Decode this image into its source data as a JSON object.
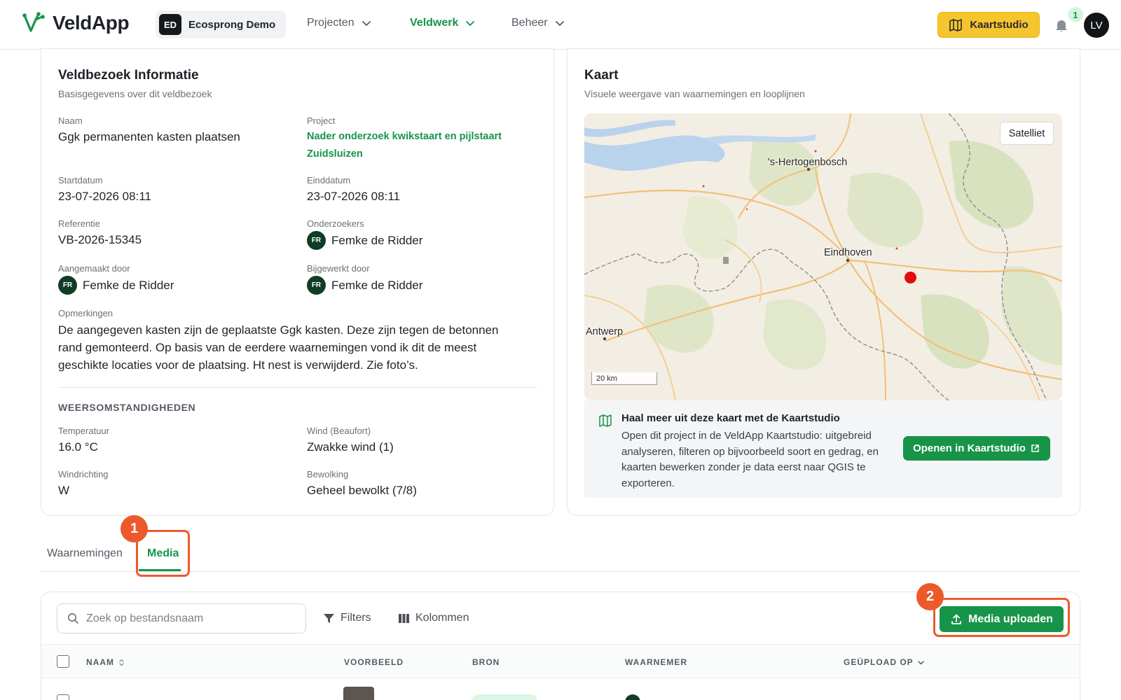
{
  "app": {
    "logo_text": "VeldApp",
    "org_initials": "ED",
    "org_name": "Ecosprong Demo"
  },
  "nav": {
    "items": [
      {
        "label": "Projecten",
        "active": false
      },
      {
        "label": "Veldwerk",
        "active": true
      },
      {
        "label": "Beheer",
        "active": false
      }
    ],
    "studio_button": "Kaartstudio",
    "notification_count": "1",
    "user_initials": "LV"
  },
  "info": {
    "title": "Veldbezoek Informatie",
    "subtitle": "Basisgegevens over dit veldbezoek",
    "naam_label": "Naam",
    "naam_value": "Ggk permanenten kasten plaatsen",
    "project_label": "Project",
    "project_value": "Nader onderzoek kwikstaart en pijlstaart Zuidsluizen",
    "startdatum_label": "Startdatum",
    "startdatum_value": "23-07-2026 08:11",
    "einddatum_label": "Einddatum",
    "einddatum_value": "23-07-2026 08:11",
    "referentie_label": "Referentie",
    "referentie_value": "VB-2026-15345",
    "onderzoekers_label": "Onderzoekers",
    "onderzoekers_initials": "FR",
    "onderzoekers_value": "Femke de Ridder",
    "aangemaakt_label": "Aangemaakt door",
    "aangemaakt_initials": "FR",
    "aangemaakt_value": "Femke de Ridder",
    "bijgewerkt_label": "Bijgewerkt door",
    "bijgewerkt_initials": "FR",
    "bijgewerkt_value": "Femke de Ridder",
    "opmerkingen_label": "Opmerkingen",
    "opmerkingen_value": "De aangegeven kasten zijn de geplaatste Ggk kasten. Deze zijn tegen de betonnen rand gemonteerd. Op basis van de eerdere waarnemingen vond ik dit de meest geschikte locaties voor de plaatsing. Ht nest is verwijderd. Zie foto’s.",
    "weather_heading": "WEERSOMSTANDIGHEDEN",
    "temperatuur_label": "Temperatuur",
    "temperatuur_value": "16.0 °C",
    "wind_label": "Wind (Beaufort)",
    "wind_value": "Zwakke wind (1)",
    "windrichting_label": "Windrichting",
    "windrichting_value": "W",
    "bewolking_label": "Bewolking",
    "bewolking_value": "Geheel bewolkt (7/8)"
  },
  "map": {
    "title": "Kaart",
    "subtitle": "Visuele weergave van waarnemingen en looplijnen",
    "satellite_button": "Satelliet",
    "places": [
      "'s-Hertogenbosch",
      "Eindhoven",
      "Antwerp"
    ],
    "scale_label": "20 km",
    "promo_title": "Haal meer uit deze kaart met de Kaartstudio",
    "promo_text": "Open dit project in de VeldApp Kaartstudio: uitgebreid analyseren, filteren op bijvoorbeeld soort en gedrag, en kaarten bewerken zonder je data eerst naar QGIS te exporteren.",
    "open_button": "Openen in Kaartstudio"
  },
  "tabs": [
    {
      "label": "Waarnemingen",
      "active": false
    },
    {
      "label": "Media",
      "active": true
    }
  ],
  "callouts": [
    "1",
    "2"
  ],
  "media": {
    "search_placeholder": "Zoek op bestandsnaam",
    "filters_label": "Filters",
    "columns_label": "Kolommen",
    "upload_button": "Media uploaden",
    "columns": [
      "NAAM",
      "VOORBEELD",
      "BRON",
      "WAARNEMER",
      "GEÜPLOAD OP"
    ]
  },
  "colors": {
    "brand_green": "#17944a",
    "accent_yellow": "#f5c52e",
    "highlight_orange": "#ec5a2c",
    "marker_red": "#e10d0d"
  }
}
